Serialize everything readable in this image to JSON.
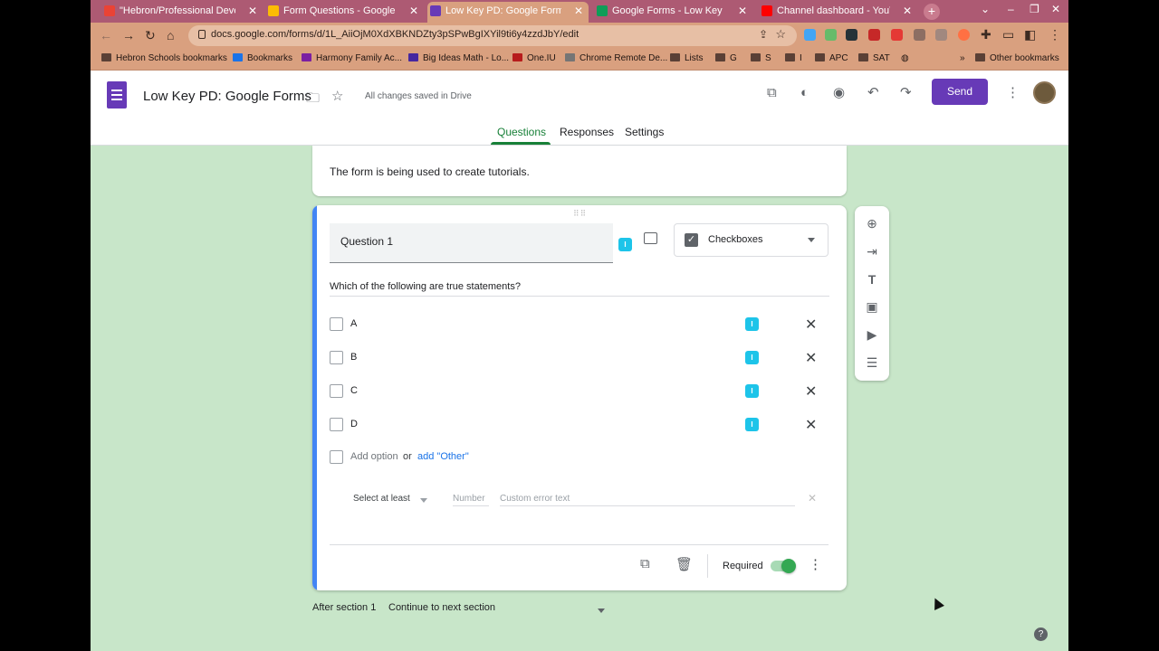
{
  "browser": {
    "tabs": [
      {
        "title": "\"Hebron/Professional Developm",
        "favicon_color": "#ea4335"
      },
      {
        "title": "Form Questions - Google Drive",
        "favicon_color": "#fbbc04"
      },
      {
        "title": "Low Key PD: Google Forms - Goo",
        "favicon_color": "#673ab7"
      },
      {
        "title": "Google Forms - Low Key PD Ide",
        "favicon_color": "#0f9d58"
      },
      {
        "title": "Channel dashboard - YouTube S",
        "favicon_color": "#ff0000"
      }
    ],
    "url": "docs.google.com/forms/d/1L_AiiOjM0XdXBKNDZty3pSPwBgIXYil9ti6y4zzdJbY/edit",
    "bookmarks": [
      "Hebron Schools bookmarks",
      "Bookmarks",
      "Harmony Family Ac...",
      "Big Ideas Math - Lo...",
      "One.IU",
      "Chrome Remote De...",
      "Lists",
      "G",
      "S",
      "I",
      "APC",
      "SAT",
      "Other bookmarks"
    ]
  },
  "form_header": {
    "title": "Low Key PD: Google Forms",
    "saved_status": "All changes saved in Drive",
    "send_label": "Send",
    "tabs": [
      "Questions",
      "Responses",
      "Settings"
    ],
    "active_tab": "Questions",
    "accent_color": "#673ab7"
  },
  "title_card": {
    "description": "The form is being used to create tutorials."
  },
  "question": {
    "title": "Question 1",
    "type": "Checkboxes",
    "description": "Which of the following are true statements?",
    "options": [
      "A",
      "B",
      "C",
      "D"
    ],
    "add_option": "Add option",
    "or": "or",
    "add_other": "add \"Other\"",
    "validation": {
      "rule": "Select at least",
      "number_placeholder": "Number",
      "error_placeholder": "Custom error text"
    },
    "required_label": "Required",
    "required": true
  },
  "after_section": {
    "label": "After section 1",
    "value": "Continue to next section"
  },
  "background_color": "#c8e6c9"
}
